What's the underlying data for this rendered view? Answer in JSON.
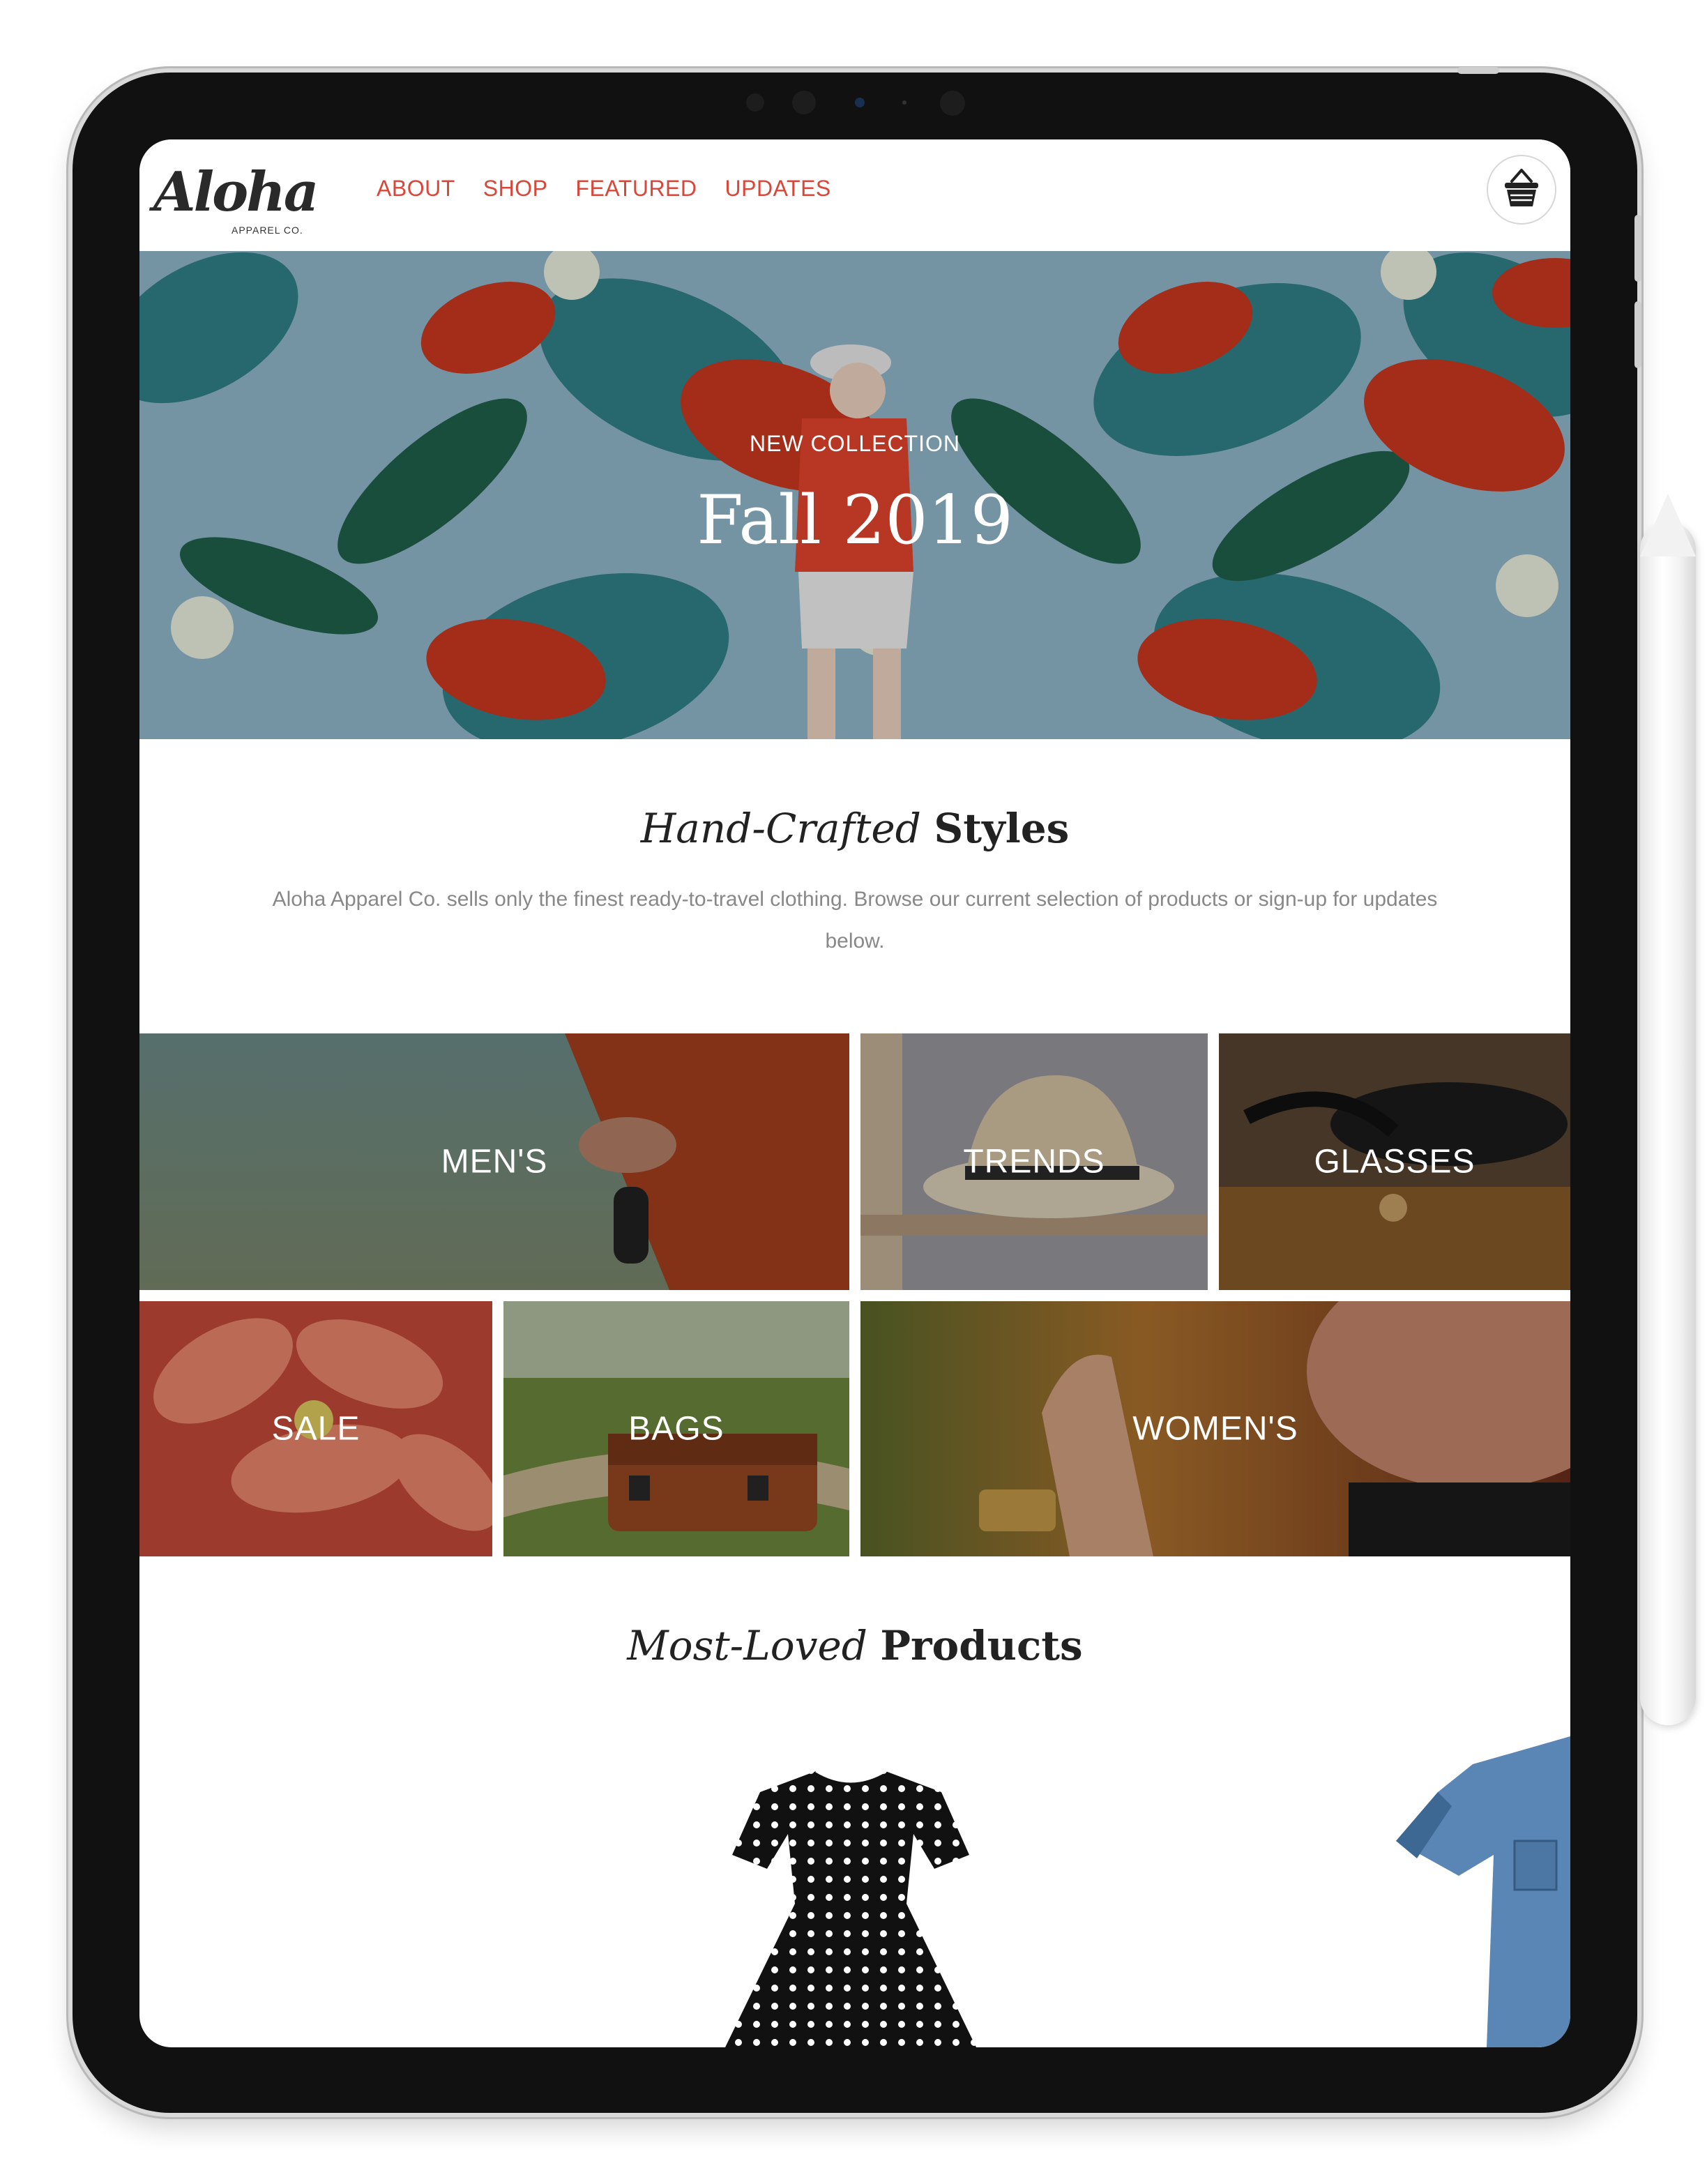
{
  "site": {
    "logo_text": "Aloha",
    "logo_subtext": "APPAREL CO."
  },
  "nav": {
    "items": [
      {
        "label": "ABOUT"
      },
      {
        "label": "SHOP"
      },
      {
        "label": "FEATURED"
      },
      {
        "label": "UPDATES"
      }
    ],
    "cart_icon": "shopping-basket-icon"
  },
  "hero": {
    "eyebrow": "NEW COLLECTION",
    "title": "Fall 2019"
  },
  "intro": {
    "heading_em": "Hand-Crafted",
    "heading_strong": "Styles",
    "body": "Aloha Apparel Co. sells only the finest ready-to-travel clothing. Browse our current selection of products or sign-up for updates below."
  },
  "categories": [
    {
      "label": "MEN'S"
    },
    {
      "label": "TRENDS"
    },
    {
      "label": "GLASSES"
    },
    {
      "label": "SALE"
    },
    {
      "label": "BAGS"
    },
    {
      "label": "WOMEN'S"
    }
  ],
  "products": {
    "heading_em": "Most-Loved",
    "heading_strong": "Products"
  },
  "colors": {
    "nav_accent": "#d9473a",
    "heading_text": "#222222",
    "body_text": "#888888",
    "hero_bg": "#8fb5c7"
  }
}
